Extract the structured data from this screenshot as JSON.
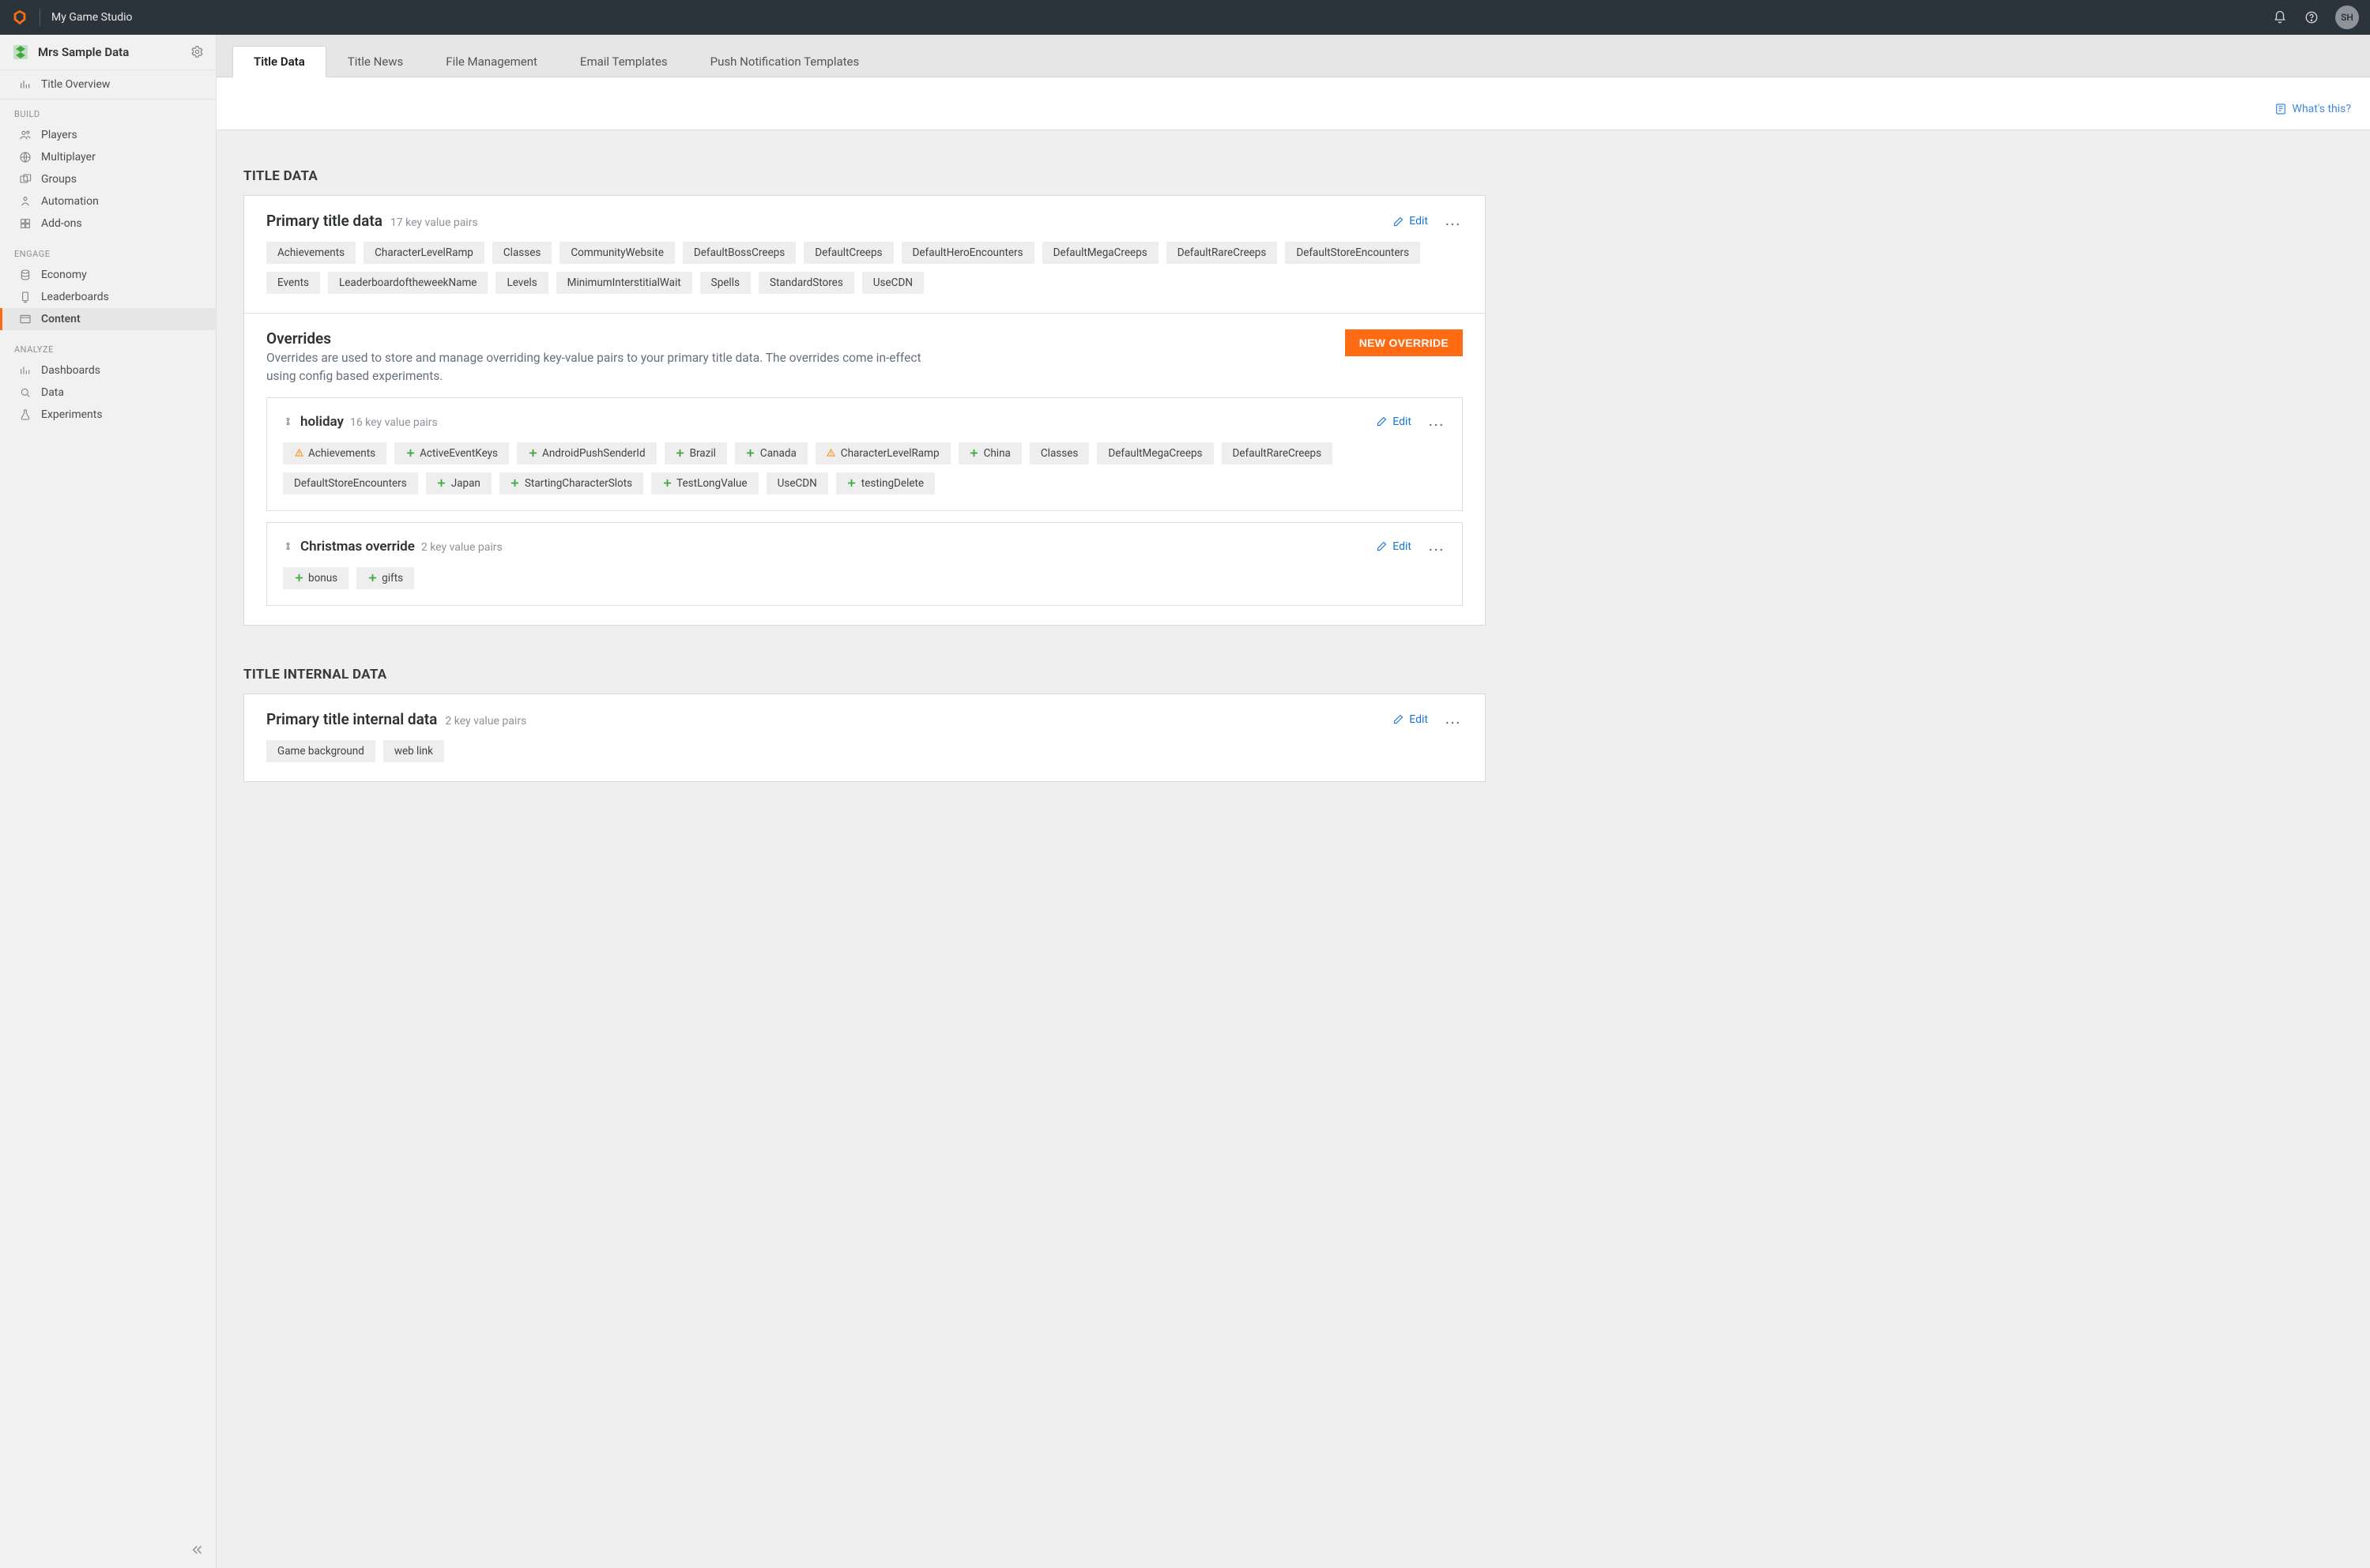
{
  "topbar": {
    "studio_name": "My Game Studio",
    "avatar_initials": "SH"
  },
  "sidebar": {
    "title_name": "Mrs Sample Data",
    "overview_label": "Title Overview",
    "sections": {
      "build": {
        "label": "BUILD",
        "items": [
          "Players",
          "Multiplayer",
          "Groups",
          "Automation",
          "Add-ons"
        ]
      },
      "engage": {
        "label": "ENGAGE",
        "items": [
          "Economy",
          "Leaderboards",
          "Content"
        ],
        "active_index": 2
      },
      "analyze": {
        "label": "ANALYZE",
        "items": [
          "Dashboards",
          "Data",
          "Experiments"
        ]
      }
    }
  },
  "tabs": {
    "items": [
      "Title Data",
      "Title News",
      "File Management",
      "Email Templates",
      "Push Notification Templates"
    ],
    "active_index": 0
  },
  "whats_this": "What's this?",
  "title_data": {
    "heading": "TITLE DATA",
    "primary": {
      "title": "Primary title data",
      "count_label": "17 key value pairs",
      "edit_label": "Edit",
      "keys": [
        "Achievements",
        "CharacterLevelRamp",
        "Classes",
        "CommunityWebsite",
        "DefaultBossCreeps",
        "DefaultCreeps",
        "DefaultHeroEncounters",
        "DefaultMegaCreeps",
        "DefaultRareCreeps",
        "DefaultStoreEncounters",
        "Events",
        "LeaderboardoftheweekName",
        "Levels",
        "MinimumInterstitialWait",
        "Spells",
        "StandardStores",
        "UseCDN"
      ]
    },
    "overrides": {
      "title": "Overrides",
      "description": "Overrides are used to store and manage overriding key-value pairs to your primary title data. The overrides come in-effect using config based experiments.",
      "new_button": "NEW OVERRIDE",
      "items": [
        {
          "name": "holiday",
          "count_label": "16 key value pairs",
          "edit_label": "Edit",
          "keys": [
            {
              "icon": "warn",
              "label": "Achievements"
            },
            {
              "icon": "add",
              "label": "ActiveEventKeys"
            },
            {
              "icon": "add",
              "label": "AndroidPushSenderId"
            },
            {
              "icon": "add",
              "label": "Brazil"
            },
            {
              "icon": "add",
              "label": "Canada"
            },
            {
              "icon": "warn",
              "label": "CharacterLevelRamp"
            },
            {
              "icon": "add",
              "label": "China"
            },
            {
              "icon": "",
              "label": "Classes"
            },
            {
              "icon": "",
              "label": "DefaultMegaCreeps"
            },
            {
              "icon": "",
              "label": "DefaultRareCreeps"
            },
            {
              "icon": "",
              "label": "DefaultStoreEncounters"
            },
            {
              "icon": "add",
              "label": "Japan"
            },
            {
              "icon": "add",
              "label": "StartingCharacterSlots"
            },
            {
              "icon": "add",
              "label": "TestLongValue"
            },
            {
              "icon": "",
              "label": "UseCDN"
            },
            {
              "icon": "add",
              "label": "testingDelete"
            }
          ]
        },
        {
          "name": "Christmas override",
          "count_label": "2 key value pairs",
          "edit_label": "Edit",
          "keys": [
            {
              "icon": "add",
              "label": "bonus"
            },
            {
              "icon": "add",
              "label": "gifts"
            }
          ]
        }
      ]
    }
  },
  "title_internal": {
    "heading": "TITLE INTERNAL DATA",
    "primary": {
      "title": "Primary title internal data",
      "count_label": "2 key value pairs",
      "edit_label": "Edit",
      "keys": [
        "Game background",
        "web link"
      ]
    }
  }
}
